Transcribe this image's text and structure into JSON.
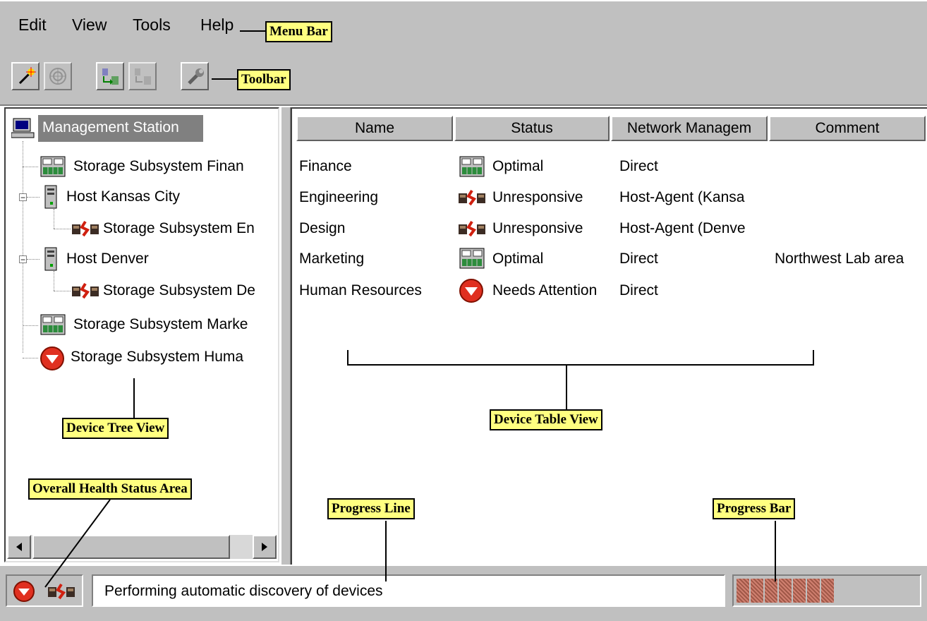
{
  "menu": {
    "items": [
      "Edit",
      "View",
      "Tools",
      "Help"
    ]
  },
  "toolbar": {
    "buttons": [
      "new-icon",
      "discover-icon",
      "add-device-icon",
      "remove-device-icon",
      "wrench-icon"
    ]
  },
  "tree": {
    "root": "Management Station",
    "items": [
      {
        "label": "Storage Subsystem Finan",
        "icon": "storage-optimal-icon"
      },
      {
        "label": "Host Kansas City",
        "icon": "host-icon"
      },
      {
        "label": "Storage Subsystem En",
        "icon": "storage-unresponsive-icon"
      },
      {
        "label": "Host Denver",
        "icon": "host-icon"
      },
      {
        "label": "Storage Subsystem De",
        "icon": "storage-unresponsive-icon"
      },
      {
        "label": "Storage Subsystem Marke",
        "icon": "storage-optimal-icon"
      },
      {
        "label": "Storage Subsystem Huma",
        "icon": "needs-attention-icon"
      }
    ]
  },
  "table": {
    "columns": [
      "Name",
      "Status",
      "Network Managem",
      "Comment"
    ],
    "rows": [
      {
        "name": "Finance",
        "status": "Optimal",
        "status_icon": "storage-optimal-icon",
        "network": "Direct",
        "comment": ""
      },
      {
        "name": "Engineering",
        "status": "Unresponsive",
        "status_icon": "storage-unresponsive-icon",
        "network": "Host-Agent (Kansa",
        "comment": ""
      },
      {
        "name": "Design",
        "status": "Unresponsive",
        "status_icon": "storage-unresponsive-icon",
        "network": "Host-Agent (Denve",
        "comment": ""
      },
      {
        "name": "Marketing",
        "status": "Optimal",
        "status_icon": "storage-optimal-icon",
        "network": "Direct",
        "comment": "Northwest Lab area"
      },
      {
        "name": "Human Resources",
        "status": "Needs Attention",
        "status_icon": "needs-attention-icon",
        "network": "Direct",
        "comment": ""
      }
    ]
  },
  "status": {
    "progress_text": "Performing automatic discovery of devices",
    "progress_blocks": 7
  },
  "callouts": {
    "menu_bar": "Menu Bar",
    "toolbar": "Toolbar",
    "device_tree_view": "Device Tree View",
    "device_table_view": "Device Table View",
    "overall_health": "Overall Health Status Area",
    "progress_line": "Progress Line",
    "progress_bar": "Progress Bar"
  },
  "colors": {
    "chrome": "#c0c0c0",
    "selection": "#808080",
    "callout": "#ffff80",
    "alert_red": "#e03020"
  }
}
